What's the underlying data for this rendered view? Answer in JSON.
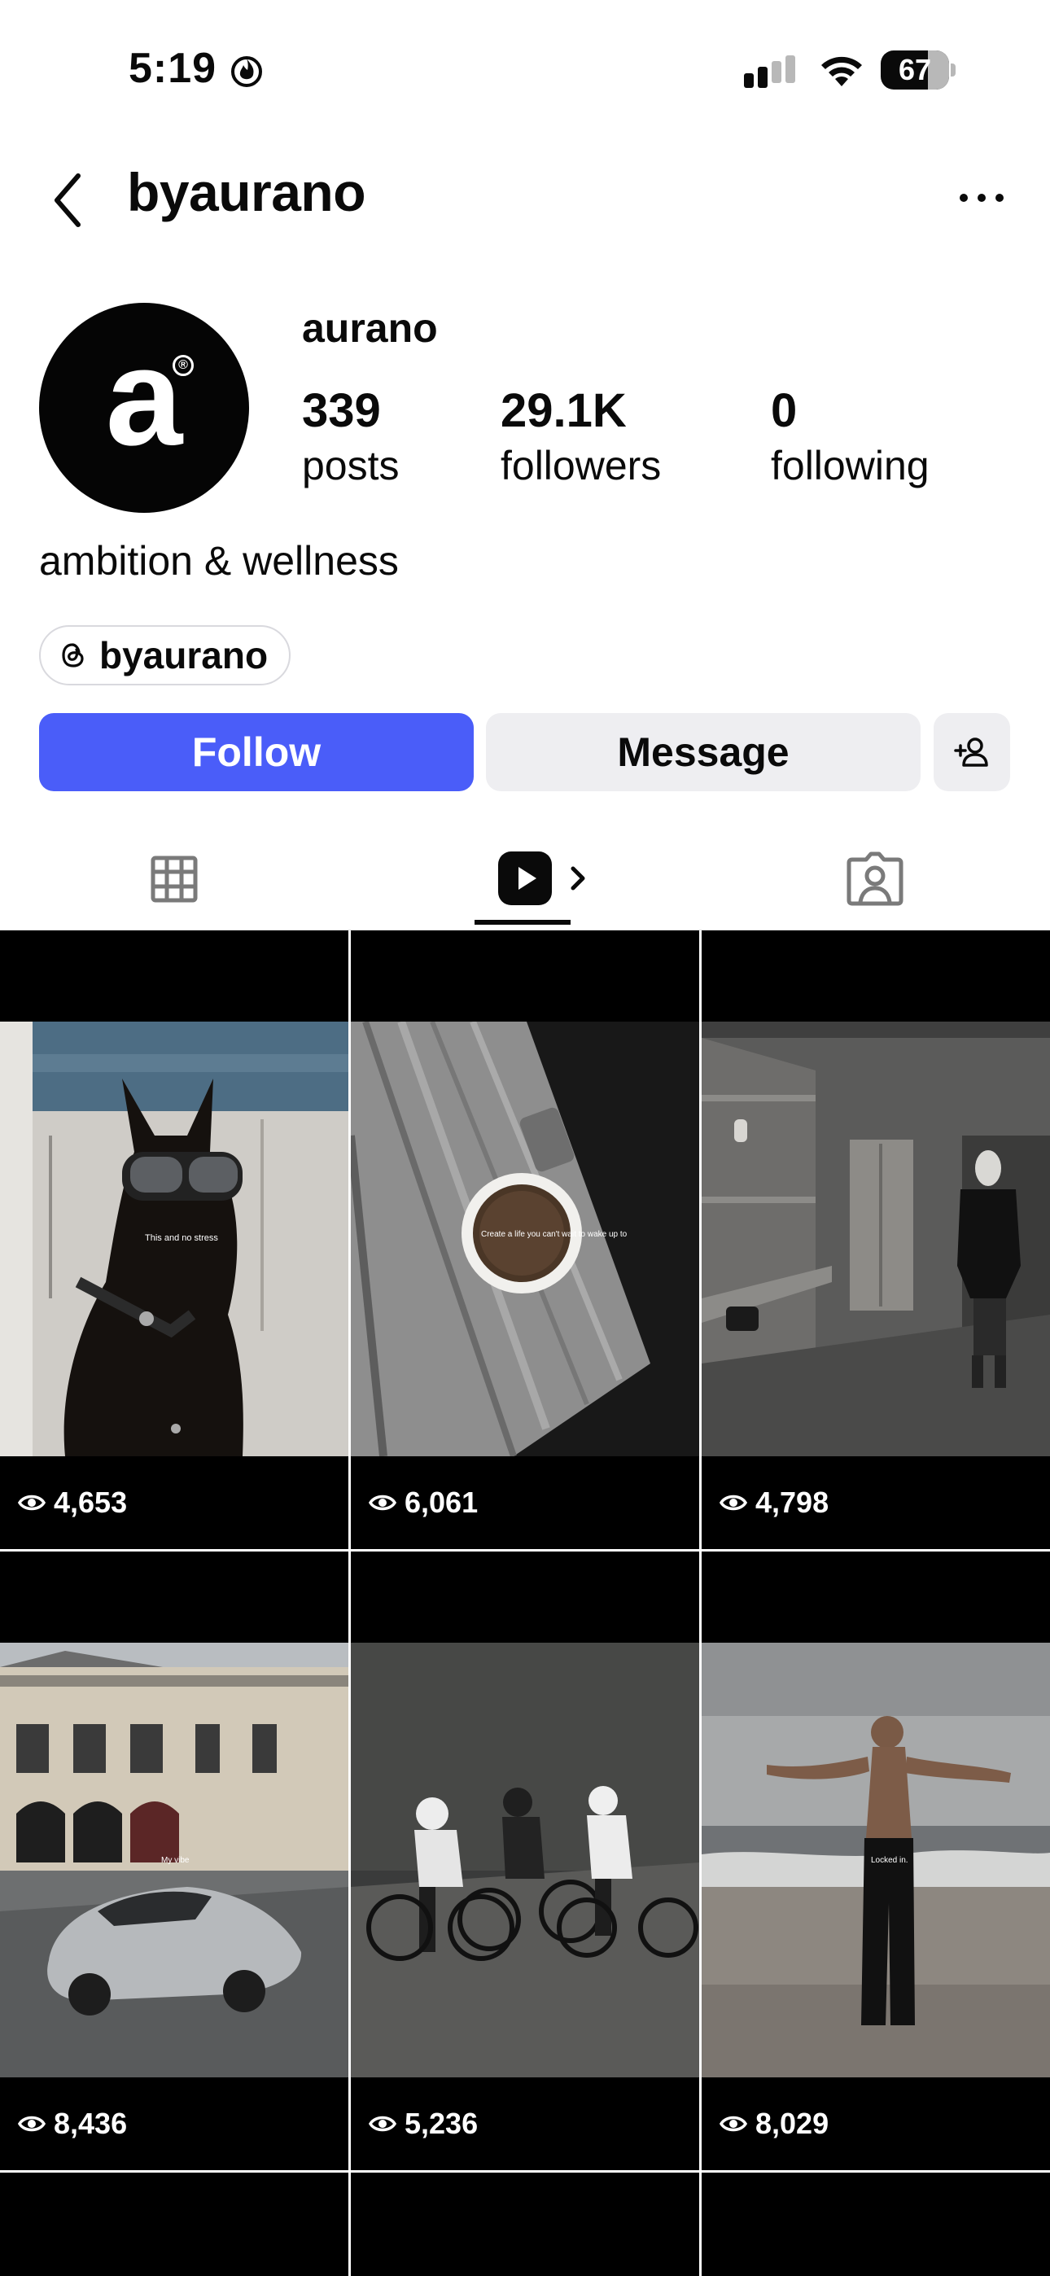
{
  "status_bar": {
    "time": "5:19",
    "battery": "67"
  },
  "header": {
    "username": "byaurano"
  },
  "profile": {
    "avatar_letter": "a",
    "avatar_mark": "®",
    "display_name": "aurano",
    "stats": [
      {
        "value": "339",
        "label": "posts"
      },
      {
        "value": "29.1K",
        "label": "followers"
      },
      {
        "value": "0",
        "label": "following"
      }
    ],
    "bio": "ambition & wellness",
    "threads_handle": "byaurano"
  },
  "actions": {
    "follow": "Follow",
    "message": "Message"
  },
  "icons": {
    "back": "chevron-left-icon",
    "more": "more-horizontal-icon",
    "threads": "threads-icon",
    "add_user": "add-user-icon",
    "grid_tab": "grid-icon",
    "reels_tab": "reels-icon",
    "tagged_tab": "tagged-person-icon",
    "views": "eye-icon"
  },
  "colors": {
    "follow_button": "#4a5df9",
    "secondary_button": "#eeeef1"
  },
  "reels": [
    {
      "views": "4,653",
      "overlay_text": "This and no stress"
    },
    {
      "views": "6,061",
      "overlay_text": "Create a life you can't wait to wake up to"
    },
    {
      "views": "4,798",
      "overlay_text": ""
    },
    {
      "views": "8,436",
      "overlay_text": "My vibe"
    },
    {
      "views": "5,236",
      "overlay_text": ""
    },
    {
      "views": "8,029",
      "overlay_text": "Locked in."
    }
  ]
}
